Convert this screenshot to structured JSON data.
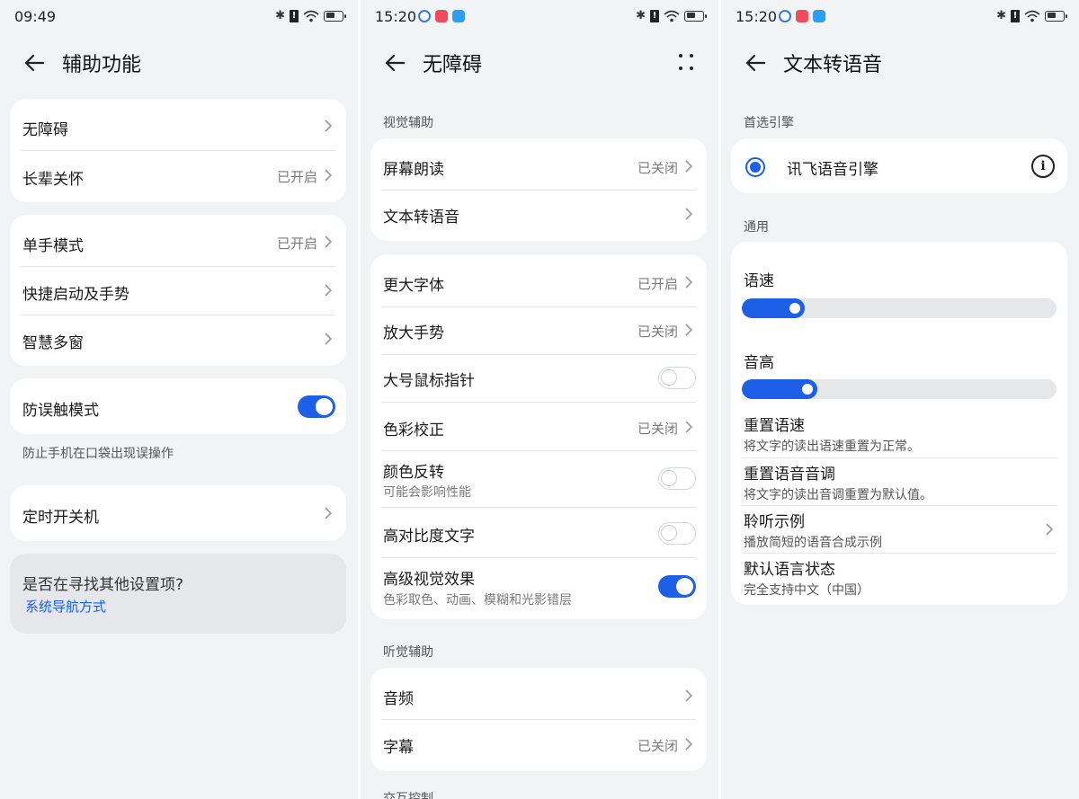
{
  "panel1": {
    "status_time": "09:49",
    "title": "辅助功能",
    "group1": [
      {
        "label": "无障碍",
        "value": ""
      },
      {
        "label": "长辈关怀",
        "value": "已开启"
      }
    ],
    "group2": [
      {
        "label": "单手模式",
        "value": "已开启"
      },
      {
        "label": "快捷启动及手势",
        "value": ""
      },
      {
        "label": "智慧多窗",
        "value": ""
      }
    ],
    "mistouch": {
      "label": "防误触模式",
      "on": true
    },
    "mistouch_note": "防止手机在口袋出现误操作",
    "schedule": {
      "label": "定时开关机"
    },
    "search": {
      "question": "是否在寻找其他设置项?",
      "link": "系统导航方式"
    }
  },
  "panel2": {
    "status_time": "15:20",
    "title": "无障碍",
    "section_visual": "视觉辅助",
    "visual_group1": [
      {
        "label": "屏幕朗读",
        "value": "已关闭"
      },
      {
        "label": "文本转语音",
        "value": ""
      }
    ],
    "visual_group2": [
      {
        "label": "更大字体",
        "value": "已开启"
      },
      {
        "label": "放大手势",
        "value": "已关闭"
      },
      {
        "label": "大号鼠标指针",
        "toggle": false
      },
      {
        "label": "色彩校正",
        "value": "已关闭"
      },
      {
        "label": "颜色反转",
        "sub": "可能会影响性能",
        "toggle": false
      },
      {
        "label": "高对比度文字",
        "toggle": false
      },
      {
        "label": "高级视觉效果",
        "sub": "色彩取色、动画、模糊和光影错层",
        "toggle": true
      }
    ],
    "section_hearing": "听觉辅助",
    "hearing_group": [
      {
        "label": "音频",
        "value": ""
      },
      {
        "label": "字幕",
        "value": "已关闭"
      }
    ],
    "section_interaction": "交互控制"
  },
  "panel3": {
    "status_time": "15:20",
    "title": "文本转语音",
    "section_engine": "首选引擎",
    "engine": {
      "label": "讯飞语音引擎",
      "selected": true
    },
    "section_general": "通用",
    "speech_rate": {
      "label": "语速",
      "level": 0.2
    },
    "pitch": {
      "label": "音高",
      "level": 0.24
    },
    "items": [
      {
        "label": "重置语速",
        "sub": "将文字的读出语速重置为正常。"
      },
      {
        "label": "重置语音音调",
        "sub": "将文字的读出音调重置为默认值。"
      },
      {
        "label": "聆听示例",
        "sub": "播放简短的语音合成示例"
      },
      {
        "label": "默认语言状态",
        "sub": "完全支持中文（中国）"
      }
    ]
  },
  "colors": {
    "accent": "#1d5fe6",
    "background": "#f1f3f5",
    "card": "#ffffff"
  }
}
